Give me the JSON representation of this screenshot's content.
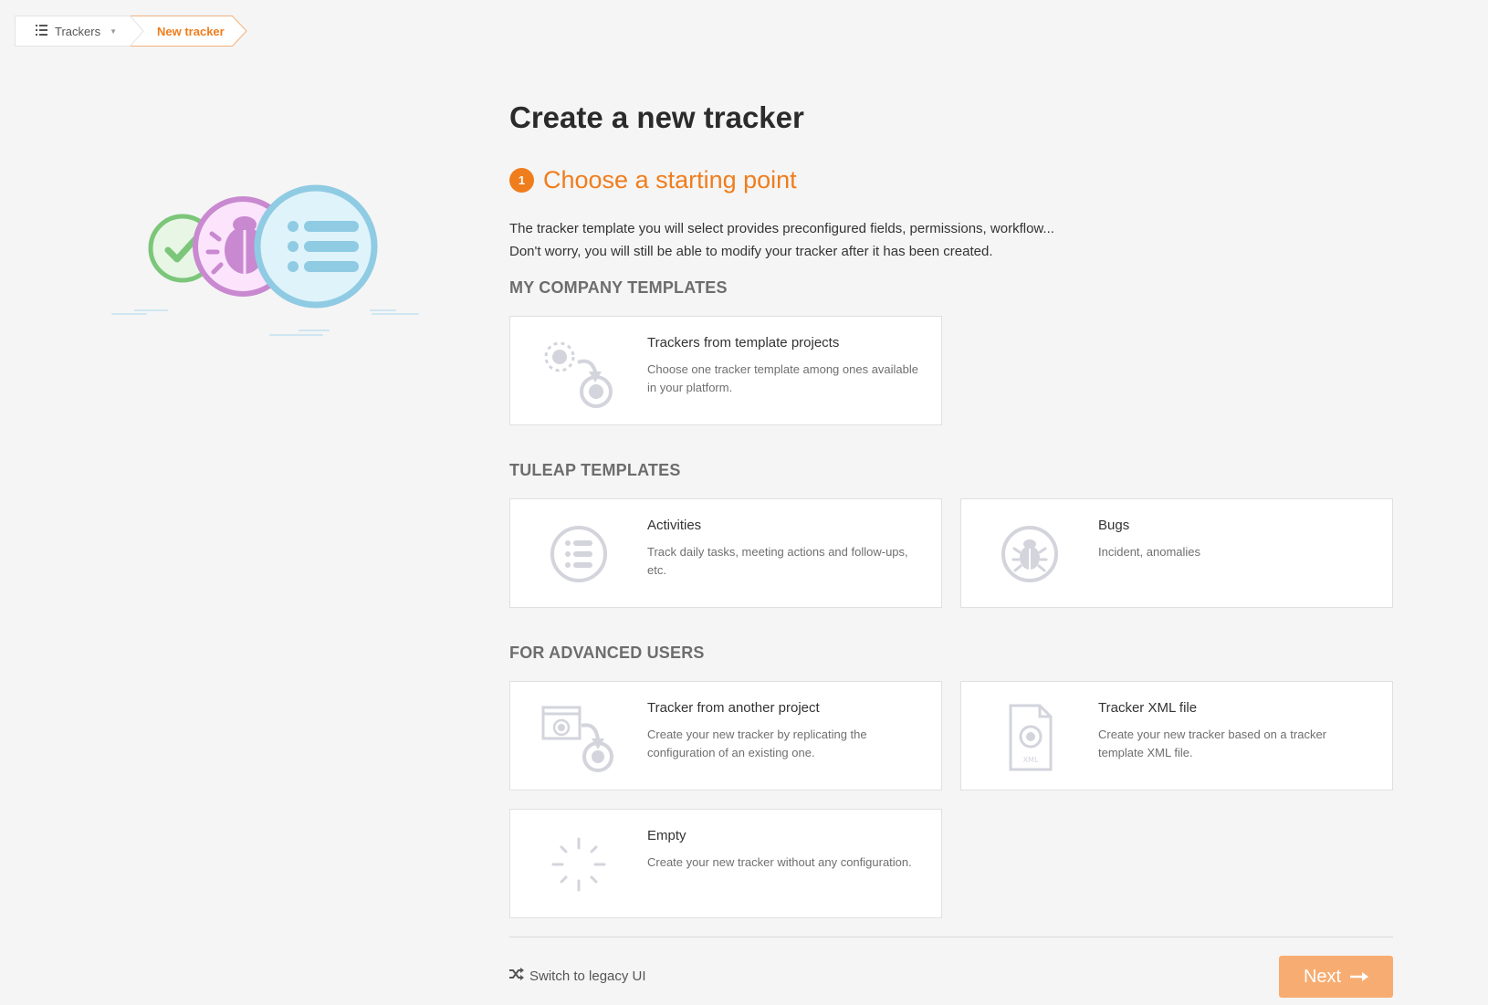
{
  "breadcrumb": {
    "trackers_label": "Trackers",
    "current_label": "New tracker",
    "trackers_icon": "list-icon",
    "caret_icon": "caret-down-icon"
  },
  "page": {
    "title": "Create a new tracker",
    "step_number": "1",
    "step_title": "Choose a starting point",
    "description_line1": "The tracker template you will select provides preconfigured fields, permissions, workflow...",
    "description_line2": "Don't worry, you will still be able to modify your tracker after it has been created."
  },
  "sections": {
    "company": {
      "title": "MY COMPANY TEMPLATES",
      "cards": [
        {
          "title": "Trackers from template projects",
          "description": "Choose one tracker template among ones available in your platform.",
          "icon": "template-projects-icon"
        }
      ]
    },
    "tuleap": {
      "title": "TULEAP TEMPLATES",
      "cards": [
        {
          "title": "Activities",
          "description": "Track daily tasks, meeting actions and follow-ups, etc.",
          "icon": "activities-list-icon"
        },
        {
          "title": "Bugs",
          "description": "Incident, anomalies",
          "icon": "bug-icon"
        }
      ]
    },
    "advanced": {
      "title": "FOR ADVANCED USERS",
      "cards": [
        {
          "title": "Tracker from another project",
          "description": "Create your new tracker by replicating the configuration of an existing one.",
          "icon": "another-project-icon"
        },
        {
          "title": "Tracker XML file",
          "description": "Create your new tracker based on a tracker template XML file.",
          "icon": "xml-file-icon",
          "icon_text": "XML"
        },
        {
          "title": "Empty",
          "description": "Create your new tracker without any configuration.",
          "icon": "empty-spinner-icon"
        }
      ]
    }
  },
  "footer": {
    "legacy_label": "Switch to legacy UI",
    "legacy_icon": "shuffle-icon",
    "next_label": "Next",
    "next_icon": "arrow-right-icon"
  },
  "colors": {
    "accent": "#f07d1c",
    "next_button": "#f7ad71",
    "card_icon": "#d3d4dc",
    "illustration_green": "#7cc67a",
    "illustration_purple": "#c989d0",
    "illustration_blue": "#8fcbe3"
  }
}
